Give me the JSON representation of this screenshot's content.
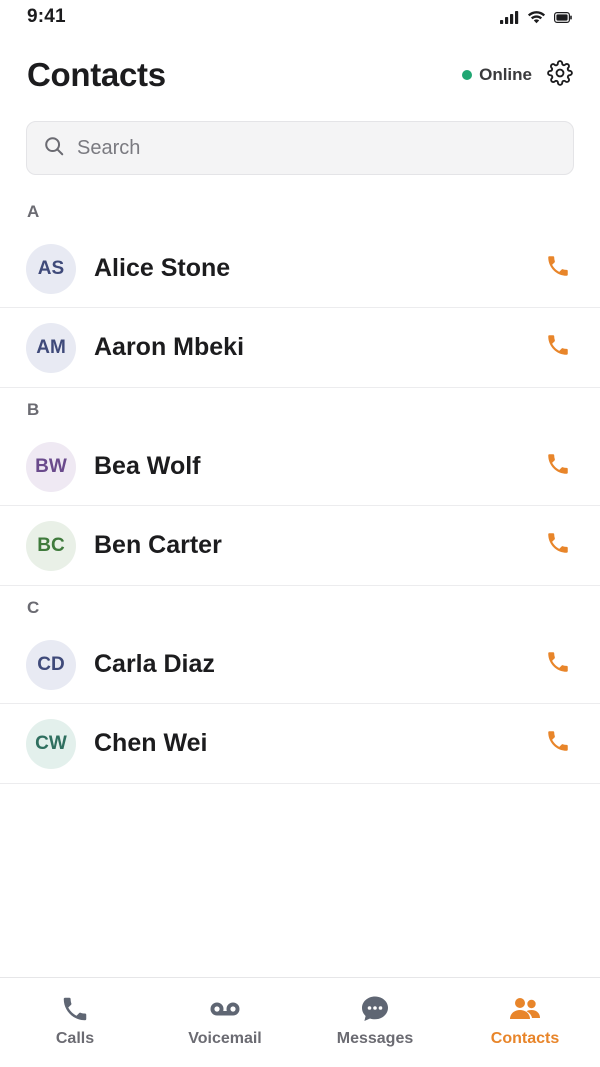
{
  "status_bar": {
    "time": "9:41",
    "icons": [
      "cellular-signal-icon",
      "wifi-icon",
      "battery-icon"
    ]
  },
  "header": {
    "title": "Contacts",
    "presence_label": "Online",
    "presence_color": "#1fa672",
    "settings_icon": "gear-icon"
  },
  "search": {
    "placeholder": "Search",
    "value": "",
    "icon": "search-icon"
  },
  "accent_color": "#e8852a",
  "sections": [
    {
      "letter": "A",
      "contacts": [
        {
          "initials": "AS",
          "name": "Alice Stone",
          "avatar_bg": "#e8eaf3",
          "avatar_fg": "#3f4a7a"
        },
        {
          "initials": "AM",
          "name": "Aaron Mbeki",
          "avatar_bg": "#e8eaf3",
          "avatar_fg": "#3f4a7a"
        }
      ]
    },
    {
      "letter": "B",
      "contacts": [
        {
          "initials": "BW",
          "name": "Bea Wolf",
          "avatar_bg": "#efe9f3",
          "avatar_fg": "#6a4a8c"
        },
        {
          "initials": "BC",
          "name": "Ben Carter",
          "avatar_bg": "#e9f0e7",
          "avatar_fg": "#3f7a3c"
        }
      ]
    },
    {
      "letter": "C",
      "contacts": [
        {
          "initials": "CD",
          "name": "Carla Diaz",
          "avatar_bg": "#e8eaf3",
          "avatar_fg": "#3f4a7a"
        },
        {
          "initials": "CW",
          "name": "Chen Wei",
          "avatar_bg": "#e3f0ec",
          "avatar_fg": "#2f6f5f"
        }
      ]
    }
  ],
  "tabs": [
    {
      "label": "Calls",
      "icon": "phone-icon",
      "active": false
    },
    {
      "label": "Voicemail",
      "icon": "voicemail-icon",
      "active": false
    },
    {
      "label": "Messages",
      "icon": "chat-bubble-icon",
      "active": false
    },
    {
      "label": "Contacts",
      "icon": "people-icon",
      "active": true
    }
  ]
}
